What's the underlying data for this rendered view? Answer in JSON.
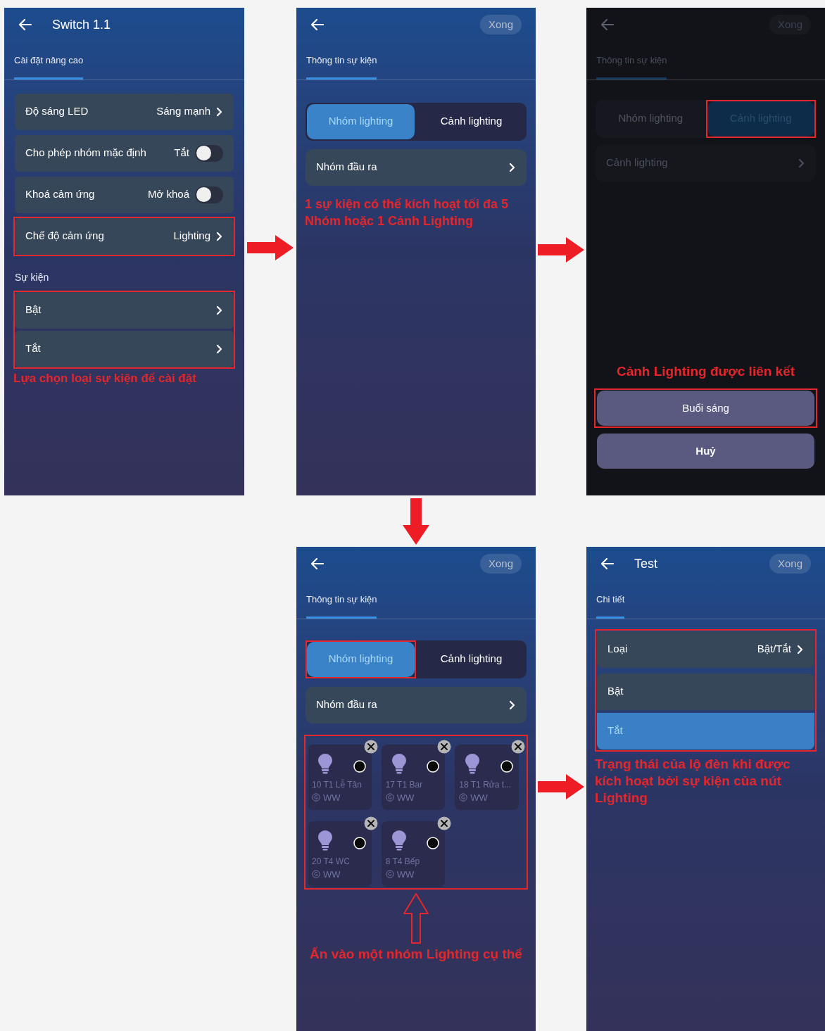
{
  "settings_screen": {
    "title": "Switch 1.1",
    "tab": "Cài đặt nâng cao",
    "rows": [
      {
        "kind": "link",
        "label": "Độ sáng LED",
        "value": "Sáng mạnh",
        "highlighted": false
      },
      {
        "kind": "toggle",
        "label": "Cho phép nhóm mặc định",
        "value": "Tắt",
        "on": false,
        "highlighted": false
      },
      {
        "kind": "toggle",
        "label": "Khoá cảm ứng",
        "value": "Mở khoá",
        "on": false,
        "highlighted": false
      },
      {
        "kind": "link",
        "label": "Chế độ cảm ứng",
        "value": "Lighting",
        "highlighted": true
      }
    ],
    "section_title": "Sự kiện",
    "events": [
      "Bật",
      "Tắt"
    ],
    "events_highlighted": true,
    "note": "Lựa chọn loại sự kiện để cài đặt"
  },
  "event_screen": {
    "done": "Xong",
    "tab": "Thông tin sự kiện",
    "segments": [
      {
        "label": "Nhóm lighting",
        "selected": true,
        "highlighted": false
      },
      {
        "label": "Cảnh lighting",
        "selected": false,
        "highlighted": false
      }
    ],
    "row": "Nhóm đầu ra",
    "note": "1 sự kiện có thể kích hoạt tối đa 5 Nhóm hoặc 1 Cảnh Lighting"
  },
  "scene_sheet_screen": {
    "done": "Xong",
    "tab": "Thông tin sự kiện",
    "segments": [
      {
        "label": "Nhóm lighting",
        "selected": false,
        "highlighted": false
      },
      {
        "label": "Cảnh lighting",
        "selected": true,
        "highlighted": true
      }
    ],
    "row": "Cảnh lighting",
    "note": "Cảnh Lighting được liên kết",
    "options": [
      {
        "label": "Buổi sáng",
        "highlighted": true
      }
    ],
    "cancel": "Huỷ"
  },
  "group_screen": {
    "done": "Xong",
    "tab": "Thông tin sự kiện",
    "segments": [
      {
        "label": "Nhóm lighting",
        "selected": true,
        "highlighted": true
      },
      {
        "label": "Cảnh lighting",
        "selected": false,
        "highlighted": false
      }
    ],
    "row": "Nhóm đầu ra",
    "groups": [
      {
        "name": "10 T1 Lễ Tân",
        "type": "WW"
      },
      {
        "name": "17 T1 Bar",
        "type": "WW"
      },
      {
        "name": "18 T1 Rửa t...",
        "type": "WW"
      },
      {
        "name": "20 T4 WC",
        "type": "WW"
      },
      {
        "name": "8 T4 Bếp",
        "type": "WW"
      }
    ],
    "groups_highlighted": true,
    "note": "Ấn vào một nhóm Lighting cụ thể"
  },
  "detail_screen": {
    "title": "Test",
    "done": "Xong",
    "tab": "Chi tiết",
    "type_row": {
      "label": "Loại",
      "value": "Bật/Tắt"
    },
    "states": [
      {
        "label": "Bật",
        "selected": false
      },
      {
        "label": "Tắt",
        "selected": true
      }
    ],
    "highlighted": true,
    "note": "Trạng thái của lộ đèn khi được kích hoạt bởi sự kiện của nút Lighting"
  }
}
